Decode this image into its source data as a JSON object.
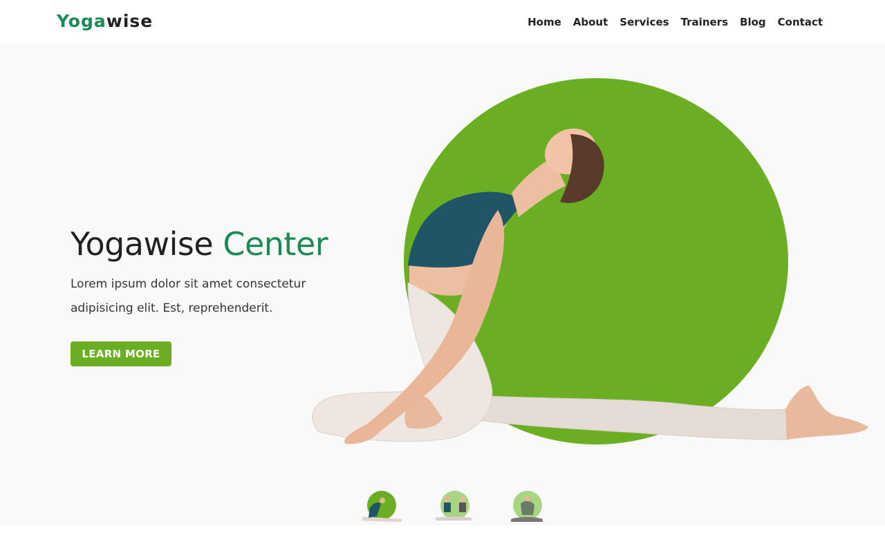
{
  "header": {
    "logo_part1": "Yoga",
    "logo_part2": "wise",
    "nav": [
      "Home",
      "About",
      "Services",
      "Trainers",
      "Blog",
      "Contact"
    ]
  },
  "hero": {
    "title_part1": "Yogawise",
    "title_part2": "Center",
    "description": "Lorem ipsum dolor sit amet consectetur adipisicing elit. Est, reprehenderit.",
    "cta_label": "LEARN MORE"
  },
  "colors": {
    "brand_green": "#1b8a55",
    "accent_green": "#6aaf22",
    "background": "#f9f9f9",
    "text_dark": "#222222"
  }
}
